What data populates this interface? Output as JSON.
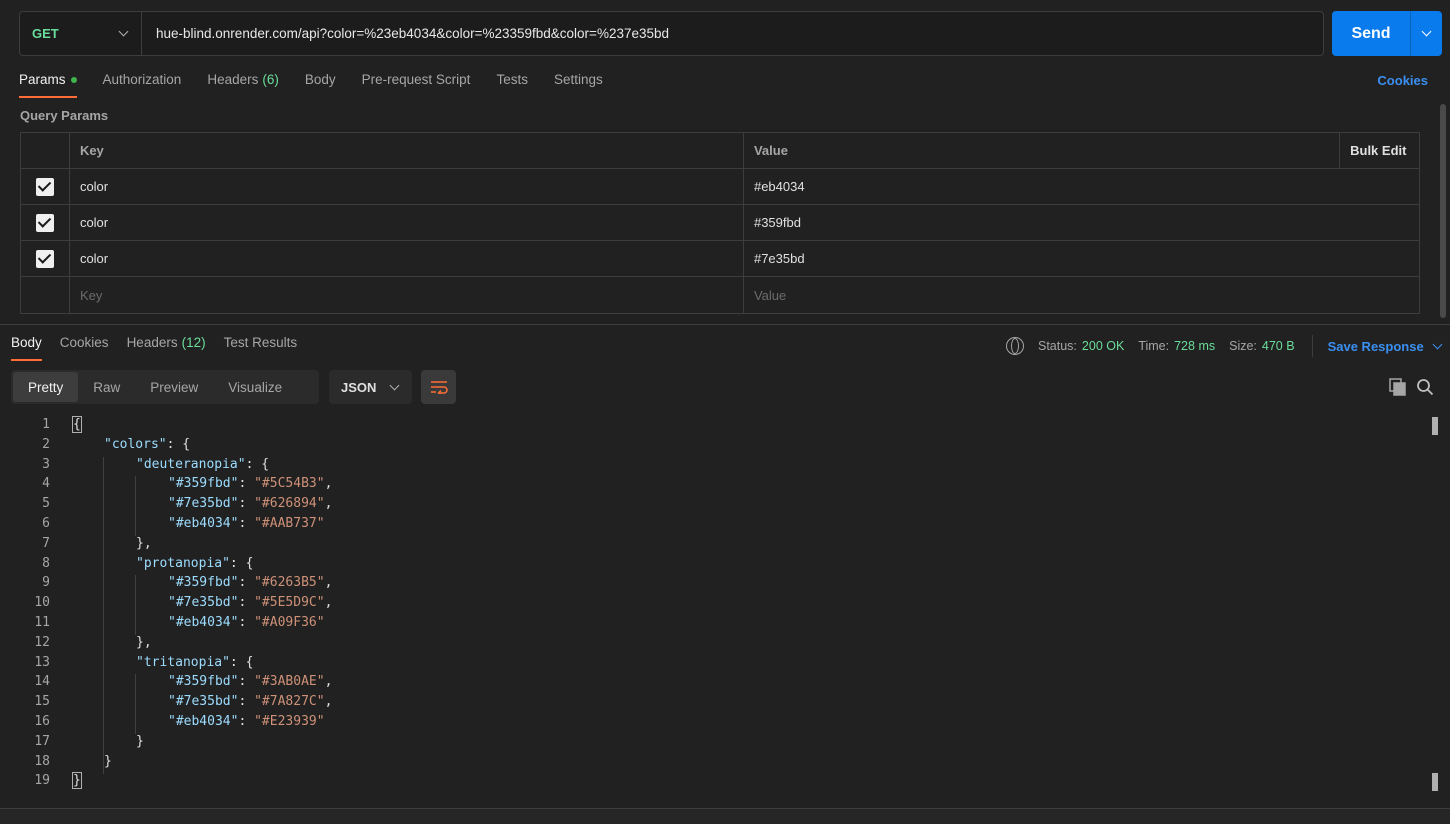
{
  "request": {
    "method": "GET",
    "url": "hue-blind.onrender.com/api?color=%23eb4034&color=%23359fbd&color=%237e35bd",
    "send_label": "Send"
  },
  "request_tabs": {
    "params": "Params",
    "authorization": "Authorization",
    "headers": "Headers",
    "headers_count": "(6)",
    "body": "Body",
    "pre_request": "Pre-request Script",
    "tests": "Tests",
    "settings": "Settings",
    "cookies": "Cookies"
  },
  "query_params": {
    "title": "Query Params",
    "col_key": "Key",
    "col_value": "Value",
    "bulk_edit": "Bulk Edit",
    "rows": [
      {
        "key": "color",
        "value": "#eb4034",
        "checked": true
      },
      {
        "key": "color",
        "value": "#359fbd",
        "checked": true
      },
      {
        "key": "color",
        "value": "#7e35bd",
        "checked": true
      }
    ],
    "key_placeholder": "Key",
    "value_placeholder": "Value"
  },
  "response_tabs": {
    "body": "Body",
    "cookies": "Cookies",
    "headers": "Headers",
    "headers_count": "(12)",
    "test_results": "Test Results"
  },
  "response_status": {
    "status_label": "Status:",
    "status_value": "200 OK",
    "time_label": "Time:",
    "time_value": "728 ms",
    "size_label": "Size:",
    "size_value": "470 B",
    "save_response": "Save Response"
  },
  "view_modes": {
    "pretty": "Pretty",
    "raw": "Raw",
    "preview": "Preview",
    "visualize": "Visualize",
    "format": "JSON"
  },
  "code": {
    "line_numbers": [
      "1",
      "2",
      "3",
      "4",
      "5",
      "6",
      "7",
      "8",
      "9",
      "10",
      "11",
      "12",
      "13",
      "14",
      "15",
      "16",
      "17",
      "18",
      "19"
    ],
    "colors_key": "\"colors\"",
    "deut_key": "\"deuteranopia\"",
    "prot_key": "\"protanopia\"",
    "trit_key": "\"tritanopia\"",
    "k1": "\"#359fbd\"",
    "k2": "\"#7e35bd\"",
    "k3": "\"#eb4034\"",
    "deut_v1": "\"#5C54B3\"",
    "deut_v2": "\"#626894\"",
    "deut_v3": "\"#AAB737\"",
    "prot_v1": "\"#6263B5\"",
    "prot_v2": "\"#5E5D9C\"",
    "prot_v3": "\"#A09F36\"",
    "trit_v1": "\"#3AB0AE\"",
    "trit_v2": "\"#7A827C\"",
    "trit_v3": "\"#E23939\""
  },
  "colors": {
    "accent": "#097bed",
    "active_tab_underline": "#ff6c37",
    "success": "#6bdd9a",
    "json_key": "#9cdcfe",
    "json_string": "#ce9178"
  }
}
